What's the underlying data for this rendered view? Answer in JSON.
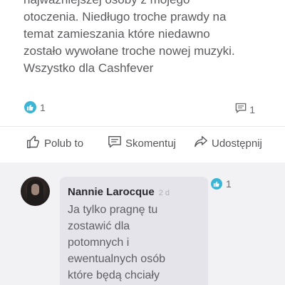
{
  "post": {
    "text_lines": [
      "najważniejszej osoby z mojego",
      "otoczenia. Niedługo troche prawdy na",
      "temat zamieszania które niedawno",
      "zostało wywołane troche nowej muzyki.",
      "Wszystko dla Cashfever"
    ],
    "like_count": "1",
    "comment_count": "1"
  },
  "actions": {
    "like_label": "Polub to",
    "comment_label": "Skomentuj",
    "share_label": "Udostępnij"
  },
  "comment": {
    "author": "Nannie Larocque",
    "time": "2 d",
    "text_lines": [
      "Ja tylko pragnę tu",
      "zostawić dla",
      "potomnych i",
      "ewentualnych osób",
      "które będą chciały"
    ],
    "like_count": "1"
  },
  "colors": {
    "accent": "#3bb5d6",
    "bubble": "#e4e4ea",
    "background": "#f2f2f4"
  },
  "icons": {
    "like_badge": "thumbs-up-icon",
    "comment_count": "comment-icon",
    "like_action": "thumbs-up-outline-icon",
    "comment_action": "comment-outline-icon",
    "share_action": "share-icon"
  }
}
